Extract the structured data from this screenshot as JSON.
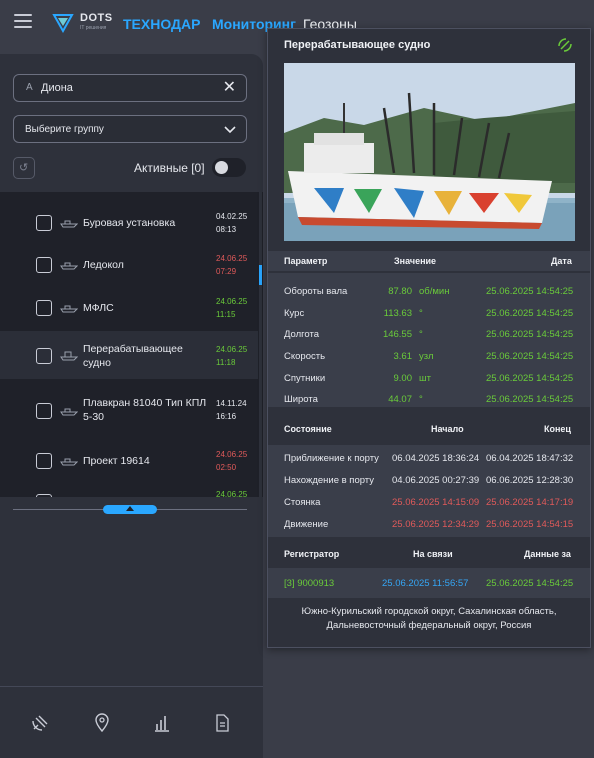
{
  "header": {
    "logo_text": "DOTS",
    "logo_sub": "IT решения",
    "brand": "ТЕХНОДАР",
    "nav_monitoring": "Мониторинг",
    "nav_geozones": "Геозоны"
  },
  "sidebar": {
    "search_value": "Диона",
    "group_placeholder": "Выберите группу",
    "active_label": "Активные [0]",
    "active_toggle_on": false,
    "items": [
      {
        "name": "Буровая установка",
        "date": "04.02.25",
        "time": "08:13",
        "status": "white"
      },
      {
        "name": "Ледокол",
        "date": "24.06.25",
        "time": "07:29",
        "status": "red"
      },
      {
        "name": "МФЛС",
        "date": "24.06.25",
        "time": "11:15",
        "status": "green"
      },
      {
        "name": "Перерабатывающее судно",
        "date": "24.06.25",
        "time": "11:18",
        "status": "green"
      },
      {
        "name": "Плавкран 81040 Тип КПЛ 5-30",
        "date": "14.11.24",
        "time": "16:16",
        "status": "white"
      },
      {
        "name": "Проект 19614",
        "date": "24.06.25",
        "time": "02:50",
        "status": "red"
      },
      {
        "name": "",
        "date": "24.06.25",
        "time": "",
        "status": "green"
      }
    ]
  },
  "card": {
    "title": "Перерабатывающее судно",
    "params_header": {
      "param": "Параметр",
      "value": "Значение",
      "date": "Дата"
    },
    "params": [
      {
        "name": "Обороты вала",
        "value": "87.80",
        "unit": "об/мин",
        "date": "25.06.2025 14:54:25"
      },
      {
        "name": "Курс",
        "value": "113.63",
        "unit": "°",
        "date": "25.06.2025 14:54:25"
      },
      {
        "name": "Долгота",
        "value": "146.55",
        "unit": "°",
        "date": "25.06.2025 14:54:25"
      },
      {
        "name": "Скорость",
        "value": "3.61",
        "unit": "узл",
        "date": "25.06.2025 14:54:25"
      },
      {
        "name": "Спутники",
        "value": "9.00",
        "unit": "шт",
        "date": "25.06.2025 14:54:25"
      },
      {
        "name": "Широта",
        "value": "44.07",
        "unit": "°",
        "date": "25.06.2025 14:54:25"
      }
    ],
    "state_header": {
      "state": "Состояние",
      "start": "Начало",
      "end": "Конец"
    },
    "states": [
      {
        "name": "Приближение к порту",
        "start": "06.04.2025 18:36:24",
        "end": "06.04.2025 18:47:32",
        "color": "white"
      },
      {
        "name": "Нахождение в порту",
        "start": "04.06.2025 00:27:39",
        "end": "06.06.2025 12:28:30",
        "color": "white"
      },
      {
        "name": "Стоянка",
        "start": "25.06.2025 14:15:09",
        "end": "25.06.2025 14:17:19",
        "color": "red"
      },
      {
        "name": "Движение",
        "start": "25.06.2025 12:34:29",
        "end": "25.06.2025 14:54:15",
        "color": "red"
      }
    ],
    "reg_header": {
      "reg": "Регистратор",
      "online": "На связи",
      "data": "Данные за"
    },
    "registrar": {
      "id": "[3] 9000913",
      "online": "25.06.2025 11:56:57",
      "data": "25.06.2025 14:54:25"
    },
    "address": "Южно-Курильский городской округ, Сахалинская область, Дальневосточный федеральный округ, Россия"
  },
  "colors": {
    "accent": "#2aa7ff",
    "green": "#6acb3a",
    "red": "#e05a5a",
    "panel": "#2e313b",
    "list_bg": "#1f2129"
  },
  "icons": [
    "menu-icon",
    "logo-icon",
    "close-icon",
    "chevron-down-icon",
    "undo-icon",
    "ship-icon",
    "signal-icon",
    "satellite-icon",
    "location-pin-icon",
    "bar-chart-icon",
    "report-icon"
  ]
}
